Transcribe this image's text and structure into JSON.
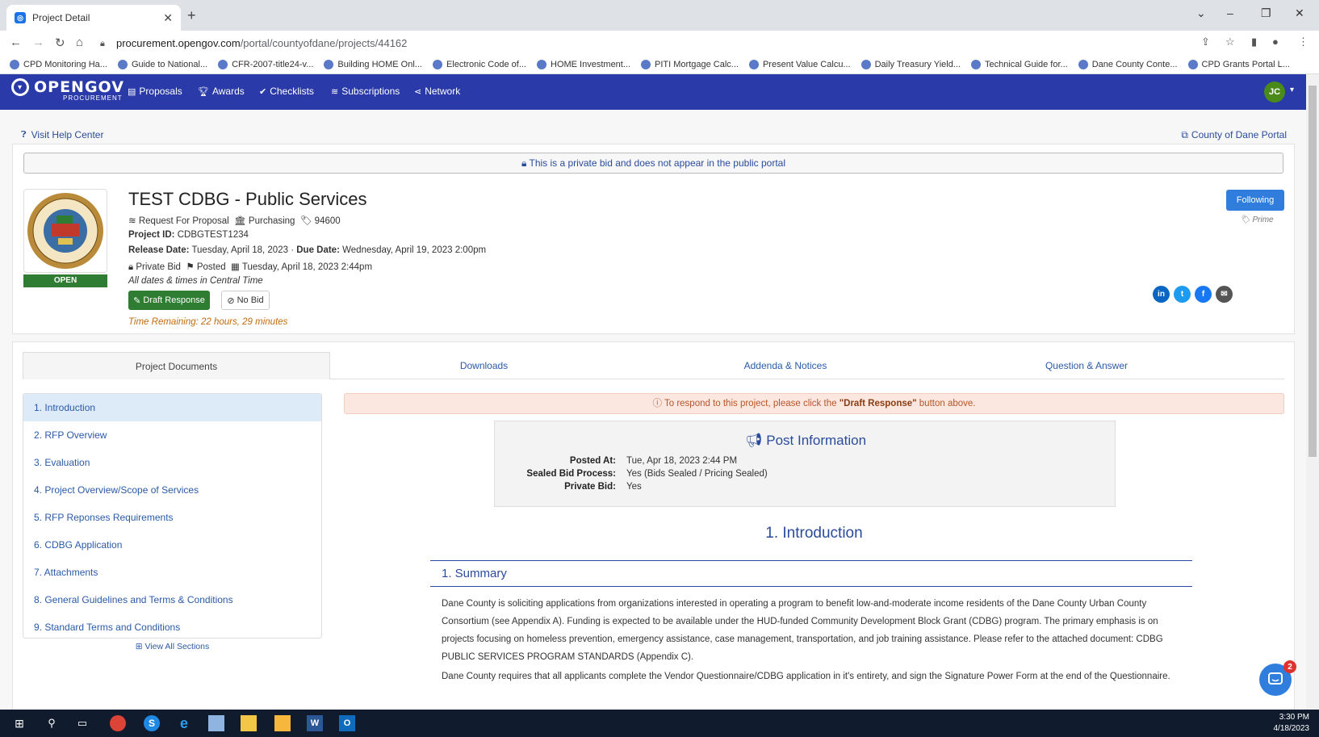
{
  "browser": {
    "tab_title": "Project Detail",
    "url_host": "procurement.opengov.com",
    "url_path": "/portal/countyofdane/projects/44162",
    "bookmarks": [
      "CPD Monitoring Ha...",
      "Guide to National...",
      "CFR-2007-title24-v...",
      "Building HOME Onl...",
      "Electronic Code of...",
      "HOME Investment...",
      "PITI Mortgage Calc...",
      "Present Value Calcu...",
      "Daily Treasury Yield...",
      "Technical Guide for...",
      "Dane County Conte...",
      "CPD Grants Portal L..."
    ]
  },
  "appnav": {
    "logo": "OPENGOV",
    "logo_sub": "PROCUREMENT",
    "links": [
      "Proposals",
      "Awards",
      "Checklists",
      "Subscriptions",
      "Network"
    ],
    "user_initials": "JC"
  },
  "page": {
    "help_link": "Visit Help Center",
    "portal_link": "County of Dane Portal",
    "private_notice": "This is a private bid and does not appear in the public portal",
    "status_badge": "OPEN",
    "project_title": "TEST CDBG - Public Services",
    "type": "Request For Proposal",
    "department": "Purchasing",
    "tag": "94600",
    "project_id_label": "Project ID:",
    "project_id": "CDBGTEST1234",
    "release_label": "Release Date:",
    "release_date": "Tuesday, April 18, 2023",
    "due_label": "Due Date:",
    "due_date": "Wednesday, April 19, 2023 2:00pm",
    "bid_type": "Private Bid",
    "posted_label": "Posted",
    "posted_date": "Tuesday, April 18, 2023 2:44pm",
    "timezone_note": "All dates & times in Central Time",
    "draft_button": "Draft Response",
    "nobid_button": "No Bid",
    "time_remaining": "Time Remaining: 22 hours, 29 minutes",
    "follow_button": "Following",
    "prime_label": "Prime"
  },
  "documents": {
    "tabs": [
      "Project Documents",
      "Downloads",
      "Addenda & Notices",
      "Question & Answer"
    ],
    "sections": [
      "1. Introduction",
      "2. RFP Overview",
      "3. Evaluation",
      "4. Project Overview/Scope of Services",
      "5. RFP Reponses Requirements",
      "6. CDBG Application",
      "7. Attachments",
      "8. General Guidelines and Terms & Conditions",
      "9. Standard Terms and Conditions"
    ],
    "view_all": "View All Sections",
    "notice_prefix": "To respond to this project, please click the ",
    "notice_bold": "\"Draft Response\"",
    "notice_suffix": " button above.",
    "post_info_title": "Post Information",
    "post_rows": [
      {
        "k": "Posted At:",
        "v": "Tue, Apr 18, 2023 2:44 PM"
      },
      {
        "k": "Sealed Bid Process:",
        "v": "Yes (Bids Sealed / Pricing Sealed)"
      },
      {
        "k": "Private Bid:",
        "v": "Yes"
      }
    ],
    "intro_heading": "1. Introduction",
    "summary_heading": "1. Summary",
    "para1": "Dane County is soliciting applications from organizations interested in operating a program to benefit low-and-moderate income residents of the Dane County Urban County Consortium (see Appendix A).  Funding is expected to be available under the HUD-funded Community Development Block Grant (CDBG) program.  The primary emphasis is on projects focusing on homeless prevention, emergency assistance, case management, transportation, and job training assistance. Please refer to the attached document:  CDBG PUBLIC SERVICES PROGRAM STANDARDS (Appendix C).",
    "para2": "Dane County requires that all applicants complete the Vendor Questionnaire/CDBG application in it's entirety, and sign the Signature Power Form at the end of the Questionnaire."
  },
  "chat_badge": "2",
  "taskbar": {
    "time": "3:30 PM",
    "date": "4/18/2023"
  }
}
